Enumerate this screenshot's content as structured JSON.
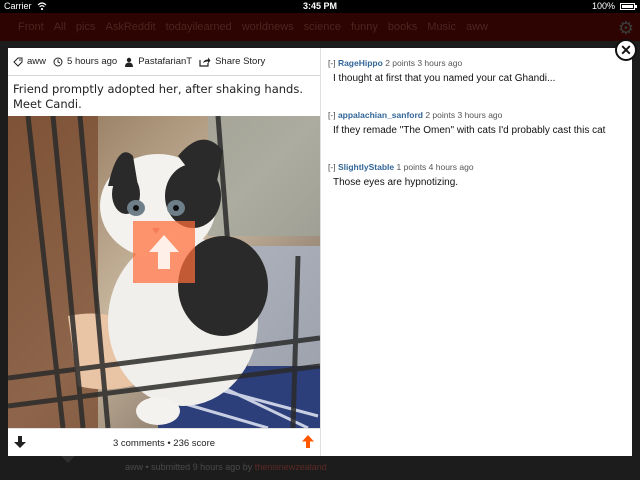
{
  "status_bar": {
    "carrier": "Carrier",
    "time": "3:45 PM",
    "battery_text": "100%",
    "battery_level": 1.0
  },
  "background": {
    "tabs": [
      "Front",
      "All",
      "pics",
      "AskReddit",
      "todayilearned",
      "worldnews",
      "science",
      "funny",
      "books",
      "Music",
      "aww"
    ],
    "subline_prefix": "aww • submitted 9 hours ago by",
    "subline_user": "thenisnewzealand"
  },
  "post": {
    "subreddit": "aww",
    "time": "5 hours ago",
    "author": "PastafarianT",
    "share_label": "Share Story",
    "title": "Friend promptly adopted her, after shaking hands. Meet Candi.",
    "footer_text": "3 comments • 236 score"
  },
  "comments": [
    {
      "toggle": "[-]",
      "author": "RageHippo",
      "meta": "2 points 3 hours ago",
      "text": "I thought at first that you named your cat Ghandi..."
    },
    {
      "toggle": "[-]",
      "author": "appalachian_sanford",
      "meta": "2 points 3 hours ago",
      "text": "If they remade \"The Omen\" with cats I'd probably cast this cat"
    },
    {
      "toggle": "[-]",
      "author": "SlightlyStable",
      "meta": "1 points 4 hours ago",
      "text": "Those eyes are hypnotizing."
    }
  ],
  "colors": {
    "accent_orange": "#ff5700",
    "author_blue": "#336699",
    "header_bg": "#2d0402"
  }
}
